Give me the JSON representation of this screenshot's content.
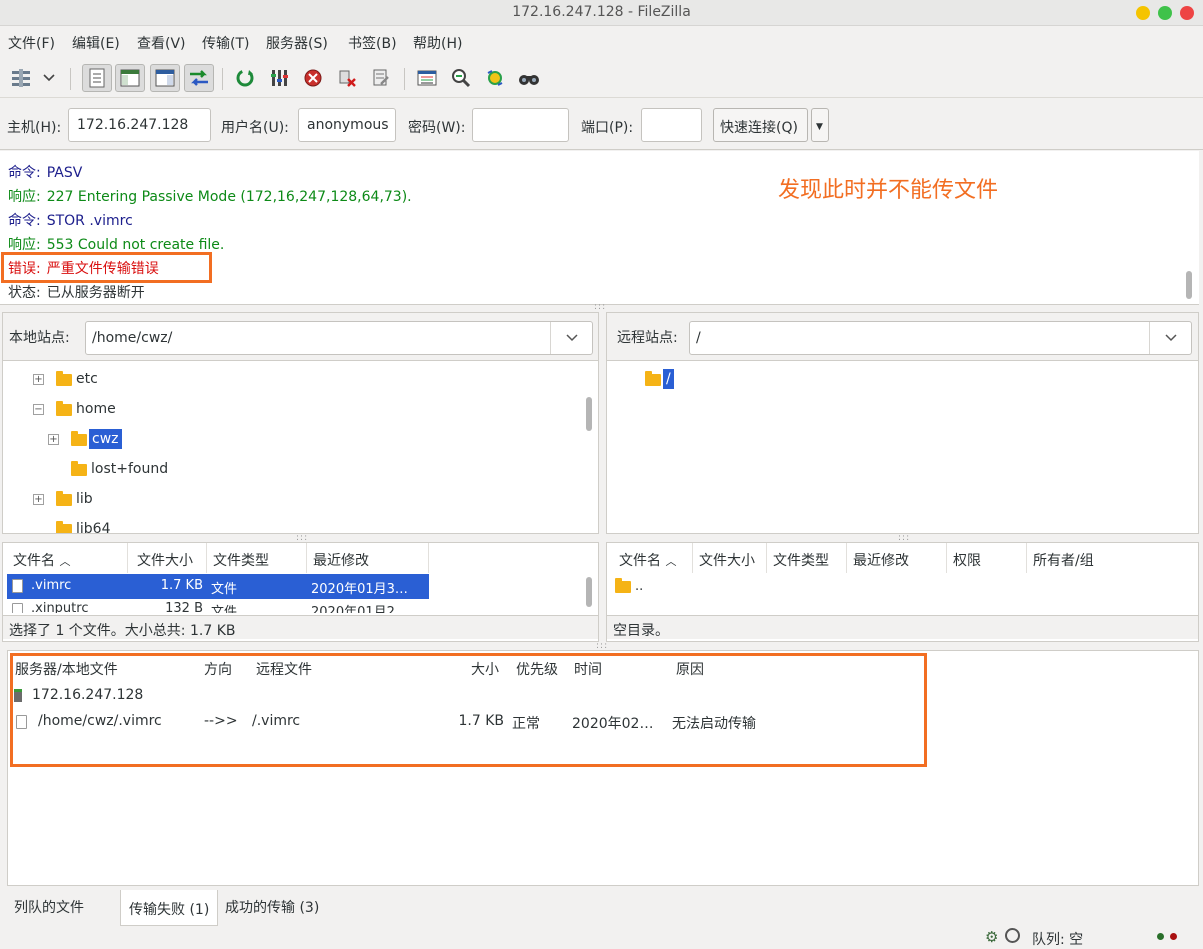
{
  "window": {
    "title": "172.16.247.128 - FileZilla"
  },
  "menu": [
    {
      "label": "文件(F)"
    },
    {
      "label": "编辑(E)"
    },
    {
      "label": "查看(V)"
    },
    {
      "label": "传输(T)"
    },
    {
      "label": "服务器(S)"
    },
    {
      "label": "书签(B)"
    },
    {
      "label": "帮助(H)"
    }
  ],
  "toolbar": {
    "icons": [
      "site-manager-icon",
      "dropdown-arrow-icon",
      "toggle-message-log-icon",
      "toggle-local-tree-icon",
      "toggle-remote-tree-icon",
      "toggle-transfer-queue-icon",
      "refresh-icon",
      "process-queue-icon",
      "cancel-icon",
      "disconnect-icon",
      "reconnect-icon",
      "directory-compare-icon",
      "filter-icon",
      "sync-browse-icon",
      "search-icon"
    ]
  },
  "quickconnect": {
    "host_label": "主机(H):",
    "host_value": "172.16.247.128",
    "user_label": "用户名(U):",
    "user_value": "anonymous",
    "pass_label": "密码(W):",
    "pass_value": "",
    "port_label": "端口(P):",
    "port_value": "",
    "button_label": "快速连接(Q)"
  },
  "log": [
    {
      "label": "命令:",
      "text": "PASV",
      "kind": "cmd"
    },
    {
      "label": "响应:",
      "text": "227 Entering Passive Mode (172,16,247,128,64,73).",
      "kind": "resp"
    },
    {
      "label": "命令:",
      "text": "STOR .vimrc",
      "kind": "cmd"
    },
    {
      "label": "响应:",
      "text": "553 Could not create file.",
      "kind": "resp"
    },
    {
      "label": "错误:",
      "text": "严重文件传输错误",
      "kind": "err"
    },
    {
      "label": "状态:",
      "text": "已从服务器断开",
      "kind": "stat"
    }
  ],
  "annotation": {
    "note": "发现此时并不能传文件"
  },
  "local": {
    "site_label": "本地站点:",
    "path": "/home/cwz/",
    "tree": [
      {
        "name": "etc",
        "expander": "+"
      },
      {
        "name": "home",
        "expander": "−"
      },
      {
        "name": "cwz",
        "expander": "+"
      },
      {
        "name": "lost+found",
        "expander": ""
      },
      {
        "name": "lib",
        "expander": "+"
      },
      {
        "name": "lib64",
        "expander": ""
      }
    ],
    "columns": [
      "文件名",
      "文件大小",
      "文件类型",
      "最近修改"
    ],
    "files": [
      {
        "name": ".vimrc",
        "size": "1.7 KB",
        "type": "文件",
        "modified": "2020年01月3…"
      },
      {
        "name": ".xinputrc",
        "size": "132 B",
        "type": "文件",
        "modified": "2020年01月2…"
      }
    ],
    "status": "选择了 1 个文件。大小总共: 1.7 KB"
  },
  "remote": {
    "site_label": "远程站点:",
    "path": "/",
    "tree": [
      {
        "name": "/"
      }
    ],
    "columns": [
      "文件名",
      "文件大小",
      "文件类型",
      "最近修改",
      "权限",
      "所有者/组"
    ],
    "files": [
      {
        "name": ".."
      }
    ],
    "status": "空目录。"
  },
  "queue": {
    "columns": [
      "服务器/本地文件",
      "方向",
      "远程文件",
      "大小",
      "优先级",
      "时间",
      "原因"
    ],
    "server": "172.16.247.128",
    "rows": [
      {
        "local": "/home/cwz/.vimrc",
        "direction": "-->>",
        "remote": "/.vimrc",
        "size": "1.7 KB",
        "priority": "正常",
        "time": "2020年02…",
        "reason": "无法启动传输"
      }
    ]
  },
  "tabs": [
    {
      "label": "列队的文件"
    },
    {
      "label": "传输失败 (1)"
    },
    {
      "label": "成功的传输 (3)"
    }
  ],
  "statusbar": {
    "queue": "队列: 空"
  }
}
